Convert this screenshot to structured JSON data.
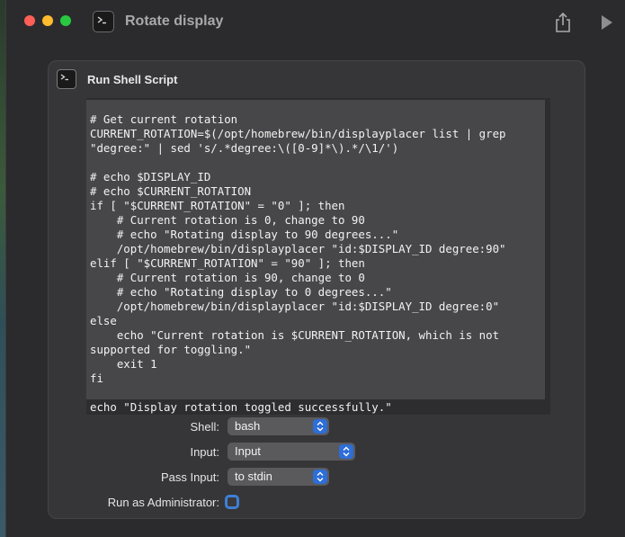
{
  "window": {
    "title": "Rotate display"
  },
  "toolbar": {
    "icons": [
      "terminal-app-icon",
      "share-icon",
      "run-icon"
    ]
  },
  "action": {
    "title": "Run Shell Script",
    "icon": "terminal-icon",
    "script": "# Get current rotation\nCURRENT_ROTATION=$(/opt/homebrew/bin/displayplacer list | grep\n\"degree:\" | sed 's/.*degree:\\([0-9]*\\).*/\\1/')\n\n# echo $DISPLAY_ID\n# echo $CURRENT_ROTATION\nif [ \"$CURRENT_ROTATION\" = \"0\" ]; then\n    # Current rotation is 0, change to 90\n    # echo \"Rotating display to 90 degrees...\"\n    /opt/homebrew/bin/displayplacer \"id:$DISPLAY_ID degree:90\"\nelif [ \"$CURRENT_ROTATION\" = \"90\" ]; then\n    # Current rotation is 90, change to 0\n    # echo \"Rotating display to 0 degrees...\"\n    /opt/homebrew/bin/displayplacer \"id:$DISPLAY_ID degree:0\"\nelse\n    echo \"Current rotation is $CURRENT_ROTATION, which is not\nsupported for toggling.\"\n    exit 1\nfi\n\necho \"Display rotation toggled successfully.\"",
    "shell": {
      "label": "Shell:",
      "value": "bash"
    },
    "input": {
      "label": "Input:",
      "value": "Input"
    },
    "pass_input": {
      "label": "Pass Input:",
      "value": "to stdin"
    },
    "run_as_admin": {
      "label": "Run as Administrator:",
      "checked": false
    }
  },
  "colors": {
    "accent": "#2d6ed8",
    "window_bg": "#2b2b2d",
    "card_bg": "#363638",
    "editor_bg": "#474749"
  }
}
